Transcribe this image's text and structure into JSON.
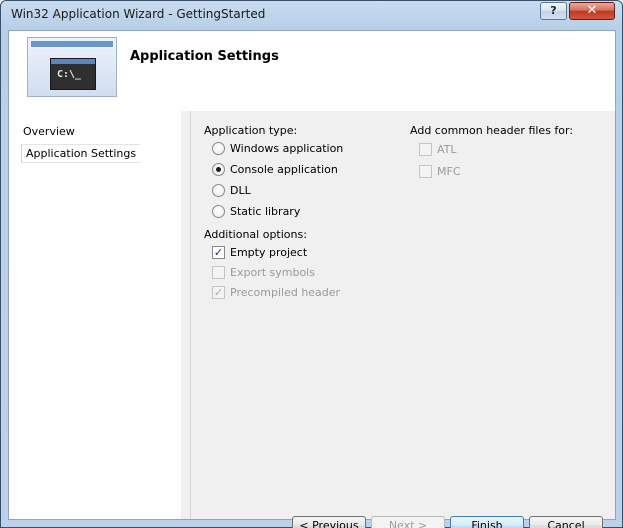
{
  "window": {
    "title": "Win32 Application Wizard - GettingStarted",
    "help_label": "?",
    "close_label": "✕"
  },
  "header": {
    "title": "Application Settings",
    "image_prompt": "C:\\_"
  },
  "nav": {
    "items": [
      {
        "label": "Overview",
        "selected": false
      },
      {
        "label": "Application Settings",
        "selected": true
      }
    ]
  },
  "application_type": {
    "label": "Application type:",
    "options": [
      {
        "label": "Windows application",
        "checked": false
      },
      {
        "label": "Console application",
        "checked": true
      },
      {
        "label": "DLL",
        "checked": false
      },
      {
        "label": "Static library",
        "checked": false
      }
    ]
  },
  "additional_options": {
    "label": "Additional options:",
    "options": [
      {
        "label": "Empty project",
        "checked": true,
        "enabled": true
      },
      {
        "label": "Export symbols",
        "checked": false,
        "enabled": false
      },
      {
        "label": "Precompiled header",
        "checked": true,
        "enabled": false
      }
    ]
  },
  "common_headers": {
    "label": "Add common header files for:",
    "options": [
      {
        "label": "ATL",
        "checked": false,
        "enabled": false
      },
      {
        "label": "MFC",
        "checked": false,
        "enabled": false
      }
    ]
  },
  "buttons": {
    "previous": "< Previous",
    "next": "Next >",
    "finish": "Finish",
    "cancel": "Cancel"
  },
  "colors": {
    "title_bar": "#c9dcf0",
    "close_button": "#c0391f",
    "content_bg": "#f0f0f0",
    "default_button": "#a8d5f5"
  }
}
